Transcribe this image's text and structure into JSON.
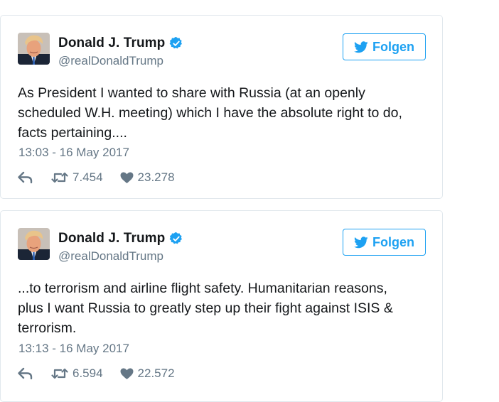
{
  "tweets": [
    {
      "author_name": "Donald J. Trump",
      "handle": "@realDonaldTrump",
      "follow_label": "Folgen",
      "text": "As President I wanted to share with Russia (at an openly\nscheduled W.H. meeting) which I have the absolute right to do,\nfacts pertaining....",
      "timestamp": "13:03 - 16 May 2017",
      "retweets": "7.454",
      "likes": "23.278"
    },
    {
      "author_name": "Donald J. Trump",
      "handle": "@realDonaldTrump",
      "follow_label": "Folgen",
      "text": "...to terrorism and airline flight safety. Humanitarian reasons,\nplus I want Russia to greatly step up their fight against ISIS &\nterrorism.",
      "timestamp": "13:13 - 16 May 2017",
      "retweets": "6.594",
      "likes": "22.572"
    }
  ],
  "icons": {
    "verified": "verified-badge-icon",
    "follow": "twitter-bird-icon",
    "reply": "reply-icon",
    "retweet": "retweet-icon",
    "like": "heart-icon"
  },
  "colors": {
    "accent": "#1da1f2",
    "muted": "#657786",
    "text": "#14171a",
    "border": "#e1e8ed"
  }
}
